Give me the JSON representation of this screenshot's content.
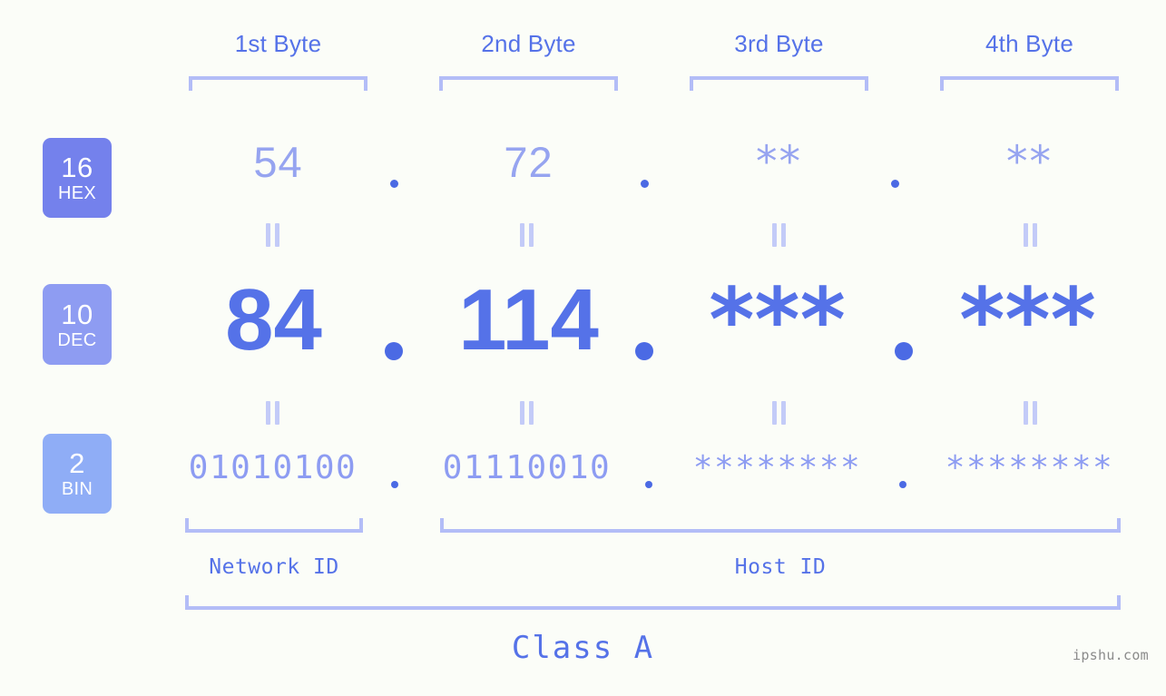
{
  "page": {
    "background": "#fbfdf8",
    "watermark": "ipshu.com",
    "class_label": "Class A"
  },
  "colors": {
    "accent_strong": "#5572e8",
    "accent_mid": "#8d9cf2",
    "accent_light": "#b3bdf7",
    "badge_hex": "#7481ec",
    "badge_dec": "#8e9cf2",
    "badge_bin": "#8fadf6",
    "dot": "#4b6ae4",
    "equals": "#c3cbf8",
    "watermark": "#8b8b8b"
  },
  "byte_headers": [
    {
      "label": "1st Byte"
    },
    {
      "label": "2nd Byte"
    },
    {
      "label": "3rd Byte"
    },
    {
      "label": "4th Byte"
    }
  ],
  "radix_badges": [
    {
      "num": "16",
      "unit": "HEX"
    },
    {
      "num": "10",
      "unit": "DEC"
    },
    {
      "num": "2",
      "unit": "BIN"
    }
  ],
  "rows": {
    "hex": {
      "values": [
        "54",
        "72",
        "**",
        "**"
      ],
      "separators": [
        ".",
        ".",
        "."
      ]
    },
    "dec": {
      "values": [
        "84",
        "114",
        "***",
        "***"
      ],
      "separators": [
        ".",
        ".",
        "."
      ]
    },
    "bin": {
      "values": [
        "01010100",
        "01110010",
        "********",
        "********"
      ],
      "separators": [
        ".",
        ".",
        "."
      ]
    }
  },
  "equality_markers": {
    "glyph": "=",
    "count_per_row": 4,
    "rows": 2
  },
  "id_sections": [
    {
      "label": "Network ID"
    },
    {
      "label": "Host ID"
    }
  ]
}
